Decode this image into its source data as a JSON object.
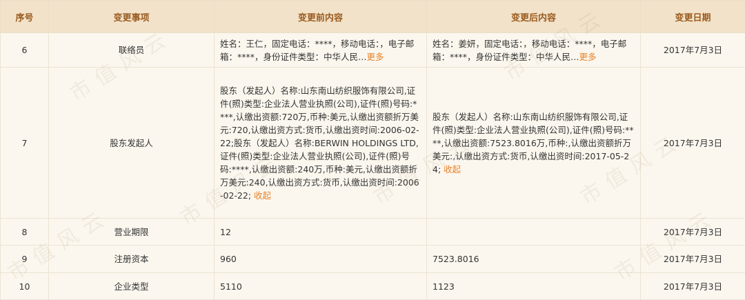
{
  "table": {
    "headers": [
      "序号",
      "变更事项",
      "变更前内容",
      "变更后内容",
      "变更日期"
    ],
    "rows": [
      {
        "no": "6",
        "item": "联络员",
        "before": "姓名：王仁，固定电话：****，移动电话：，电子邮箱：****，身份证件类型：中华人民…",
        "before_link": "更多",
        "after": "姓名：姜妍，固定电话：，移动电话：****，电子邮箱：****，身份证件类型：中华人民…",
        "after_link": "更多",
        "date": "2017年7月3日"
      },
      {
        "no": "7",
        "item": "股东发起人",
        "before": "股东（发起人）名称:山东南山纺织服饰有限公司,证件(照)类型:企业法人营业执照(公司),证件(照)号码:****,认缴出资额:720万,币种:美元,认缴出资额折万美元:720,认缴出资方式:货币,认缴出资时间:2006-02-22;股东（发起人）名称:BERWIN HOLDINGS LTD,证件(照)类型:企业法人营业执照(公司),证件(照)号码:****,认缴出资额:240万,币种:美元,认缴出资额折万美元:240,认缴出资方式:货币,认缴出资时间:2006-02-22;",
        "before_link": "收起",
        "after": "股东（发起人）名称:山东南山纺织服饰有限公司,证件(照)类型:企业法人营业执照(公司),证件(照)号码:****,认缴出资额:7523.8016万,币种:,认缴出资额折万美元:,认缴出资方式:货币,认缴出资时间:2017-05-24;",
        "after_link": "收起",
        "date": "2017年7月3日"
      },
      {
        "no": "8",
        "item": "营业期限",
        "before": "12",
        "after": "",
        "date": "2017年7月3日"
      },
      {
        "no": "9",
        "item": "注册资本",
        "before": "960",
        "after": "7523.8016",
        "date": "2017年7月3日"
      },
      {
        "no": "10",
        "item": "企业类型",
        "before": "5110",
        "after": "1123",
        "date": "2017年7月3日"
      }
    ]
  },
  "watermark": "市值风云"
}
